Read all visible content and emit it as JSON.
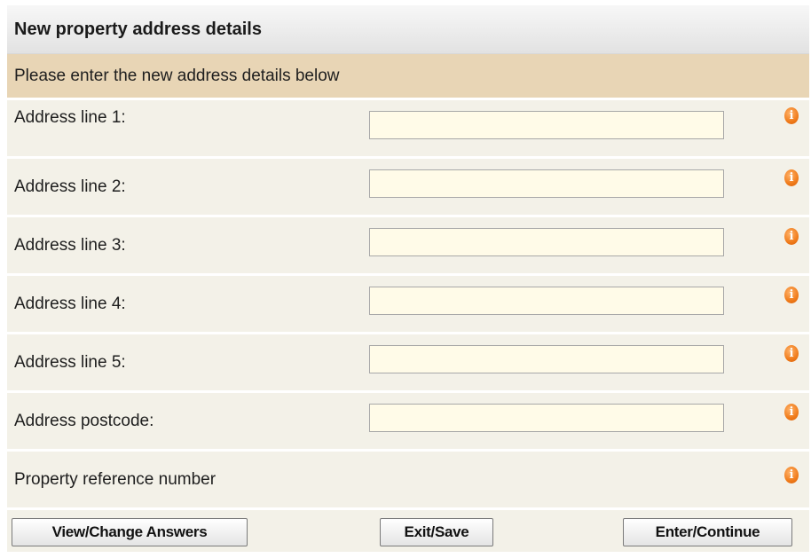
{
  "panel": {
    "title": "New property address details",
    "instruction": "Please enter the new address details below"
  },
  "fields": [
    {
      "label": "Address line 1:",
      "value": ""
    },
    {
      "label": "Address line 2:",
      "value": ""
    },
    {
      "label": "Address line 3:",
      "value": ""
    },
    {
      "label": "Address line 4:",
      "value": ""
    },
    {
      "label": "Address line 5:",
      "value": ""
    },
    {
      "label": "Address postcode:",
      "value": ""
    }
  ],
  "property_reference": {
    "label": "Property reference number"
  },
  "info_icon": {
    "glyph": "i",
    "color": "#f07b1a"
  },
  "buttons": {
    "view_change": "View/Change Answers",
    "exit_save": "Exit/Save",
    "enter_continue": "Enter/Continue"
  },
  "colors": {
    "subheader_bg": "#e8d5b5",
    "row_bg": "#f3f1e8",
    "input_bg": "#fffbe8"
  }
}
